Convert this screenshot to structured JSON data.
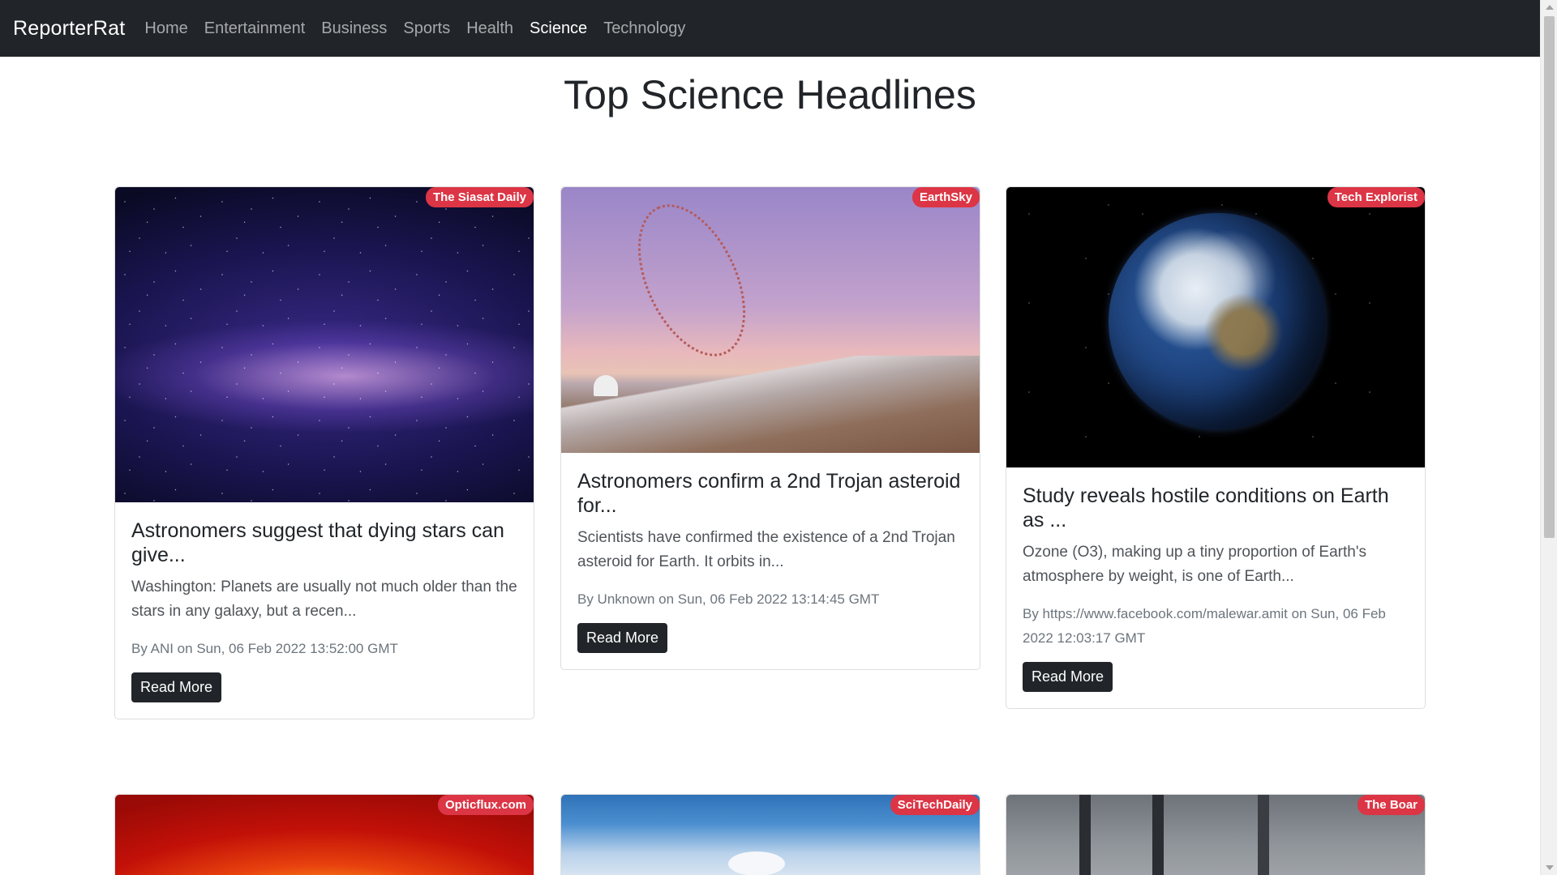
{
  "navbar": {
    "brand": "ReporterRat",
    "links": [
      {
        "label": "Home",
        "active": false
      },
      {
        "label": "Entertainment",
        "active": false
      },
      {
        "label": "Business",
        "active": false
      },
      {
        "label": "Sports",
        "active": false
      },
      {
        "label": "Health",
        "active": false
      },
      {
        "label": "Science",
        "active": true
      },
      {
        "label": "Technology",
        "active": false
      }
    ]
  },
  "page_title": "Top Science Headlines",
  "cards": [
    {
      "source": "The Siasat Daily",
      "title": "Astronomers suggest that dying stars can give...",
      "description": "Washington: Planets are usually not much older than the stars in any galaxy, but a recen...",
      "meta": "By ANI on Sun, 06 Feb 2022 13:52:00 GMT",
      "button": "Read More",
      "image": "milky-way-image"
    },
    {
      "source": "EarthSky",
      "title": "Astronomers confirm a 2nd Trojan asteroid for...",
      "description": "Scientists have confirmed the existence of a 2nd Trojan asteroid for Earth. It orbits in...",
      "meta": "By Unknown on Sun, 06 Feb 2022 13:14:45 GMT",
      "button": "Read More",
      "image": "asteroid-orbit-image"
    },
    {
      "source": "Tech Explorist",
      "title": "Study reveals hostile conditions on Earth as ...",
      "description": "Ozone (O3), making up a tiny proportion of Earth's atmosphere by weight, is one of Earth...",
      "meta": "By https://www.facebook.com/malewar.amit on Sun, 06 Feb 2022 12:03:17 GMT",
      "button": "Read More",
      "image": "earth-image"
    },
    {
      "source": "Opticflux.com",
      "image": "sun-image"
    },
    {
      "source": "SciTechDaily",
      "image": "clouds-mountain-image"
    },
    {
      "source": "The Boar",
      "image": "office-meeting-image"
    }
  ],
  "colors": {
    "navbar_bg": "#212529",
    "badge_bg": "#dc3545",
    "button_bg": "#212529"
  }
}
